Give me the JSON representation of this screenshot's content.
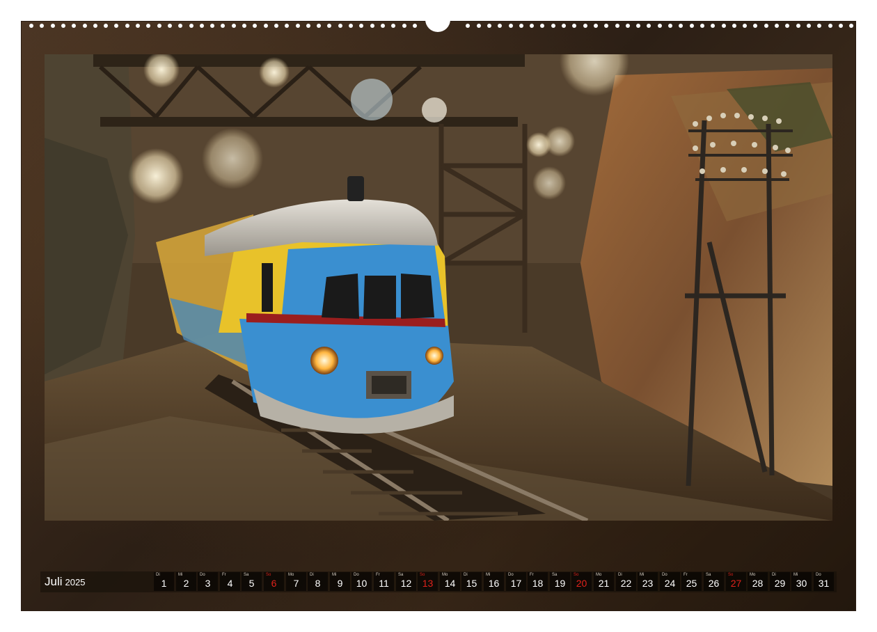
{
  "calendar": {
    "month": "Juli",
    "year": "2025",
    "days": [
      {
        "day": "1",
        "weekday": "Di",
        "sunday": false
      },
      {
        "day": "2",
        "weekday": "Mi",
        "sunday": false
      },
      {
        "day": "3",
        "weekday": "Do",
        "sunday": false
      },
      {
        "day": "4",
        "weekday": "Fr",
        "sunday": false
      },
      {
        "day": "5",
        "weekday": "Sa",
        "sunday": false
      },
      {
        "day": "6",
        "weekday": "So",
        "sunday": true
      },
      {
        "day": "7",
        "weekday": "Mo",
        "sunday": false
      },
      {
        "day": "8",
        "weekday": "Di",
        "sunday": false
      },
      {
        "day": "9",
        "weekday": "Mi",
        "sunday": false
      },
      {
        "day": "10",
        "weekday": "Do",
        "sunday": false
      },
      {
        "day": "11",
        "weekday": "Fr",
        "sunday": false
      },
      {
        "day": "12",
        "weekday": "Sa",
        "sunday": false
      },
      {
        "day": "13",
        "weekday": "So",
        "sunday": true
      },
      {
        "day": "14",
        "weekday": "Mo",
        "sunday": false
      },
      {
        "day": "15",
        "weekday": "Di",
        "sunday": false
      },
      {
        "day": "16",
        "weekday": "Mi",
        "sunday": false
      },
      {
        "day": "17",
        "weekday": "Do",
        "sunday": false
      },
      {
        "day": "18",
        "weekday": "Fr",
        "sunday": false
      },
      {
        "day": "19",
        "weekday": "Sa",
        "sunday": false
      },
      {
        "day": "20",
        "weekday": "So",
        "sunday": true
      },
      {
        "day": "21",
        "weekday": "Mo",
        "sunday": false
      },
      {
        "day": "22",
        "weekday": "Di",
        "sunday": false
      },
      {
        "day": "23",
        "weekday": "Mi",
        "sunday": false
      },
      {
        "day": "24",
        "weekday": "Do",
        "sunday": false
      },
      {
        "day": "25",
        "weekday": "Fr",
        "sunday": false
      },
      {
        "day": "26",
        "weekday": "Sa",
        "sunday": false
      },
      {
        "day": "27",
        "weekday": "So",
        "sunday": true
      },
      {
        "day": "28",
        "weekday": "Mo",
        "sunday": false
      },
      {
        "day": "29",
        "weekday": "Di",
        "sunday": false
      },
      {
        "day": "30",
        "weekday": "Mi",
        "sunday": false
      },
      {
        "day": "31",
        "weekday": "Do",
        "sunday": false
      }
    ]
  },
  "colors": {
    "sunday": "#e0221b",
    "frame": "#3b2a1b",
    "train_blue": "#3a8fd0",
    "train_yellow": "#e8c22a",
    "train_roof": "#c9c4bb"
  }
}
